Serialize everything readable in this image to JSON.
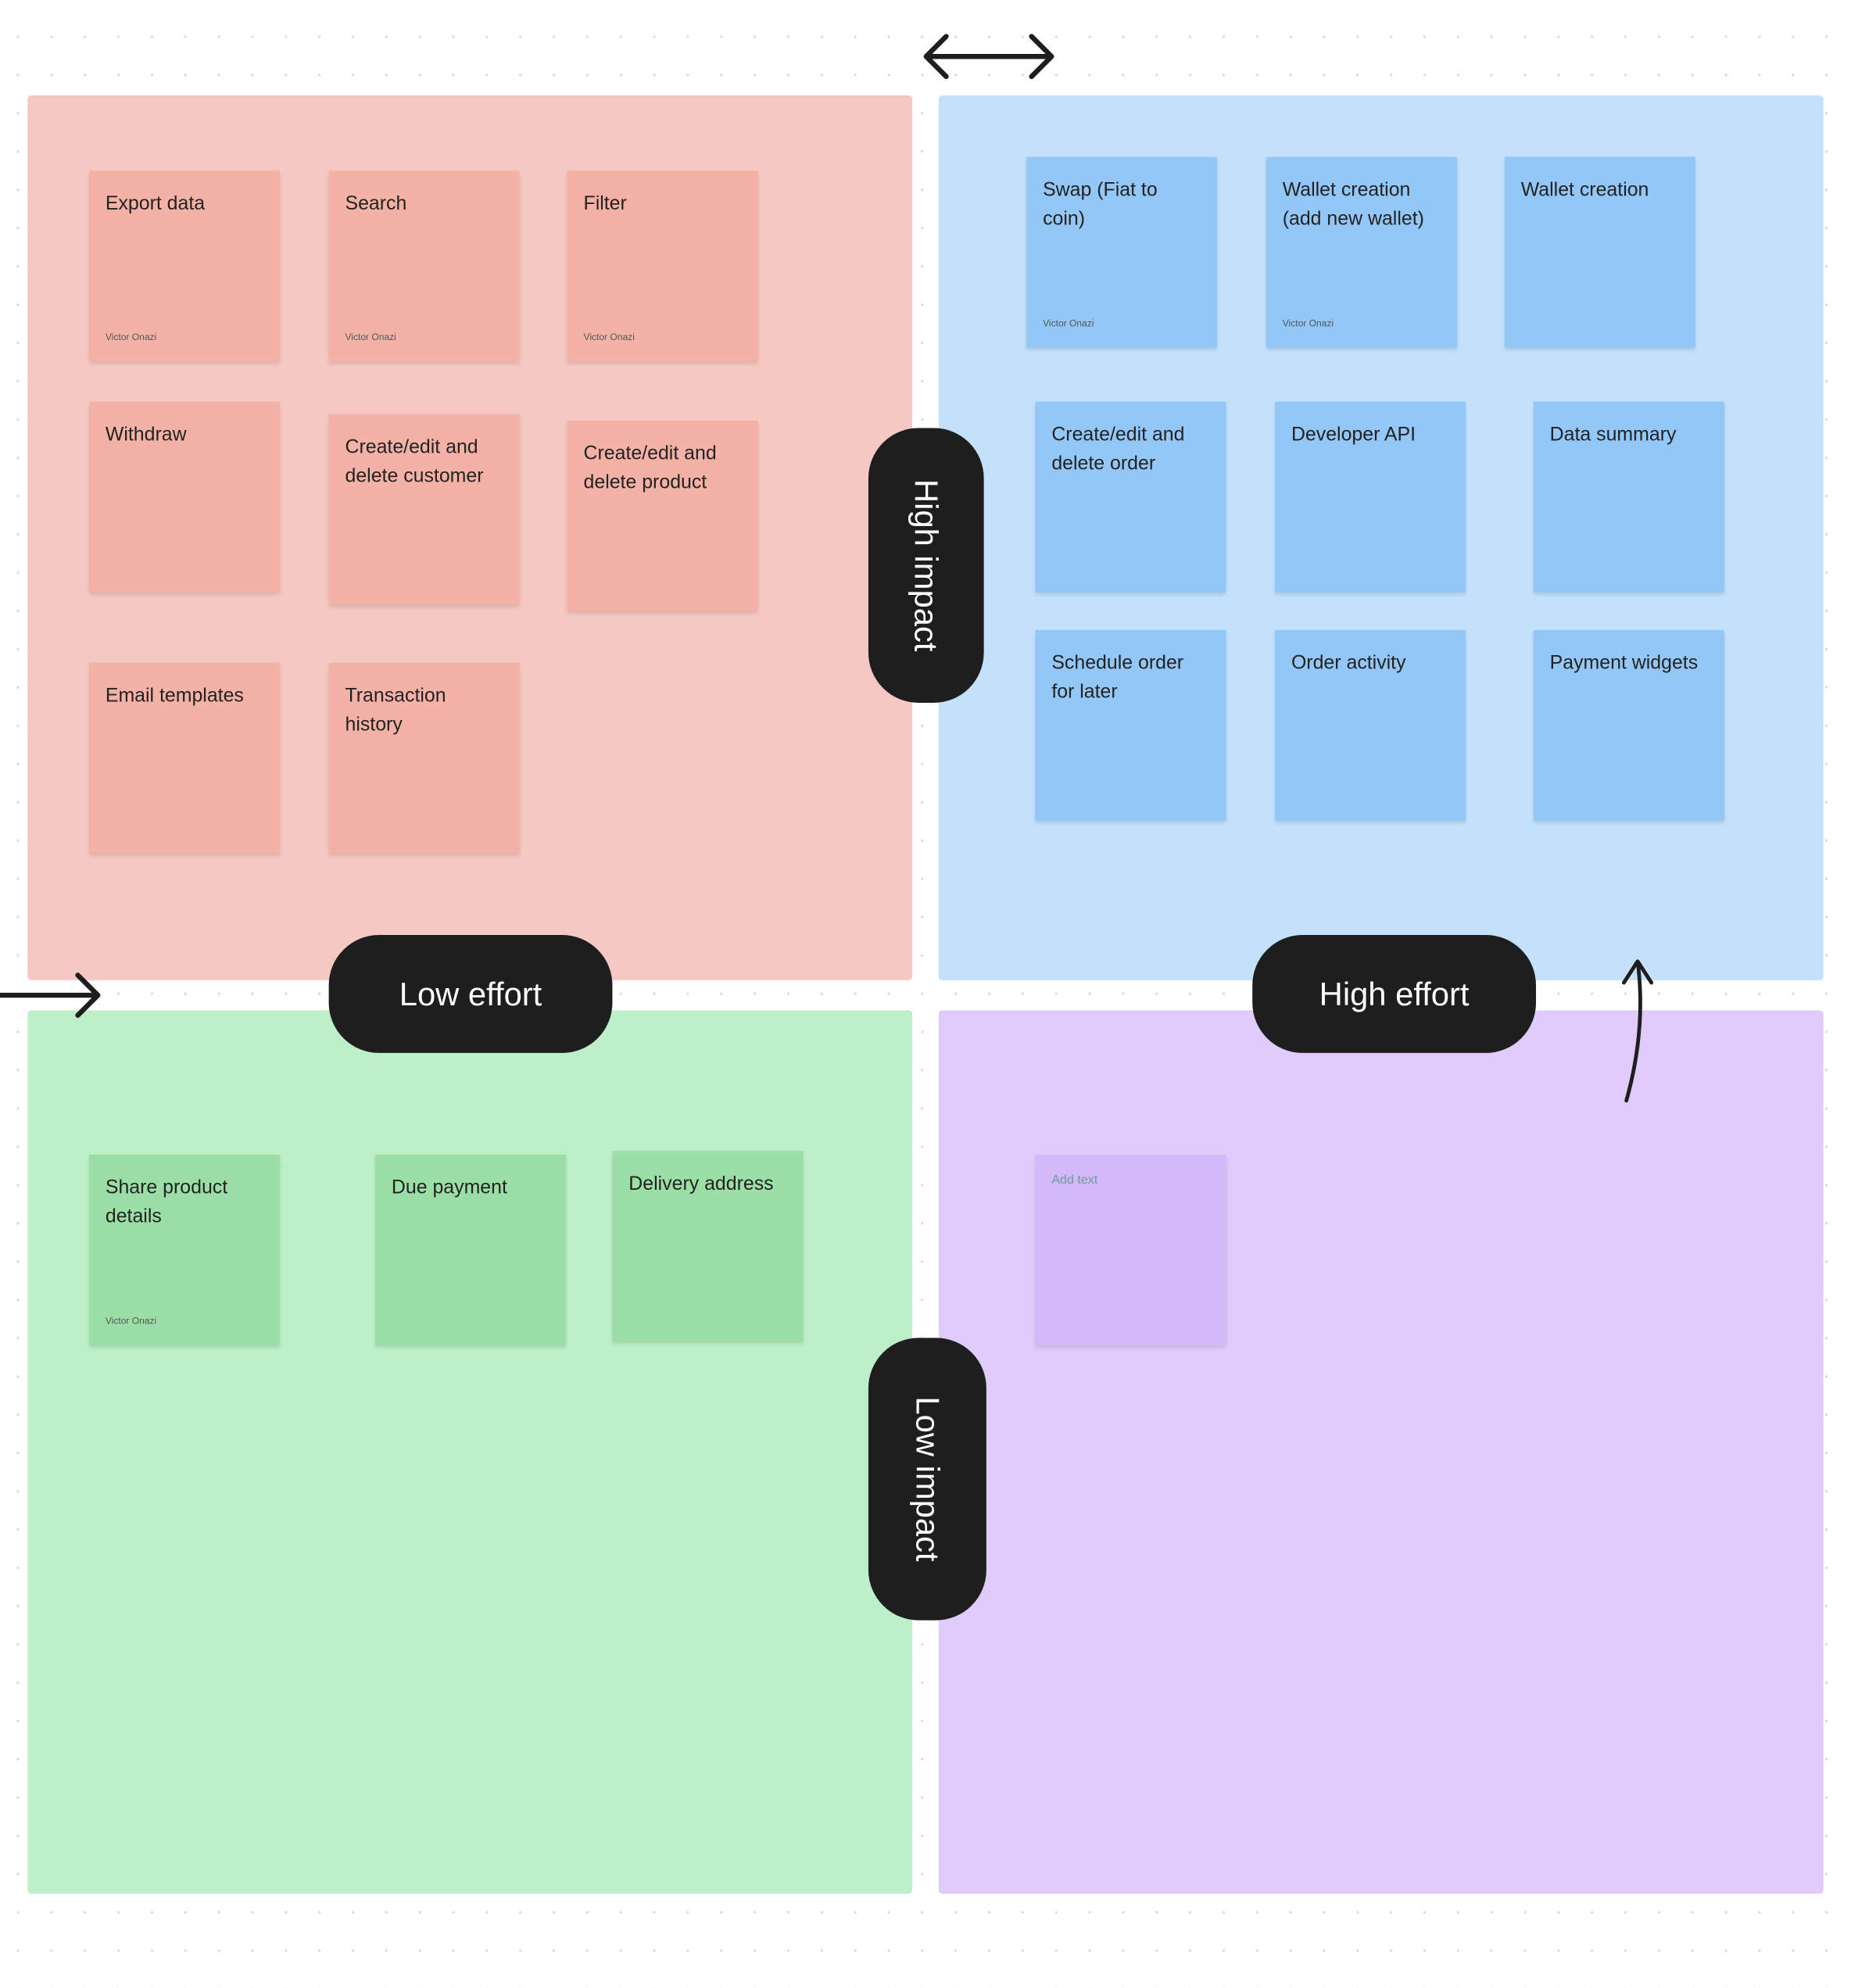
{
  "colors": {
    "pink_bg": "#f5c8c3",
    "pink_sticky": "#f4b2a7",
    "blue_bg": "#c3e1fb",
    "blue_sticky": "#92c7f8",
    "green_bg": "#bdefc9",
    "green_sticky": "#9bdea6",
    "purple_bg": "#e0cbfa",
    "purple_sticky": "#d4b9f8",
    "pill": "#1e1e1e"
  },
  "labels": {
    "high_impact": "High impact",
    "low_impact": "Low impact",
    "low_effort": "Low effort",
    "high_effort": "High effort"
  },
  "quadrants": {
    "pink": [
      {
        "text": "Export data",
        "author": "Victor Onazi"
      },
      {
        "text": "Search",
        "author": "Victor Onazi"
      },
      {
        "text": "Filter",
        "author": "Victor Onazi"
      },
      {
        "text": "Withdraw"
      },
      {
        "text": "Create/edit and delete customer"
      },
      {
        "text": "Create/edit and delete product"
      },
      {
        "text": "Email templates"
      },
      {
        "text": "Transaction history"
      }
    ],
    "blue": [
      {
        "text": "Swap (Fiat to coin)",
        "author": "Victor Onazi"
      },
      {
        "text": "Wallet creation (add new wallet)",
        "author": "Victor Onazi"
      },
      {
        "text": "Wallet creation"
      },
      {
        "text": "Create/edit and delete order"
      },
      {
        "text": "Developer API"
      },
      {
        "text": "Data summary"
      },
      {
        "text": "Schedule order for later"
      },
      {
        "text": "Order activity"
      },
      {
        "text": "Payment widgets"
      }
    ],
    "green": [
      {
        "text": "Share product details",
        "author": "Victor Onazi"
      },
      {
        "text": "Due payment"
      },
      {
        "text": "Delivery address"
      }
    ],
    "purple": [
      {
        "placeholder": "Add text"
      }
    ]
  }
}
